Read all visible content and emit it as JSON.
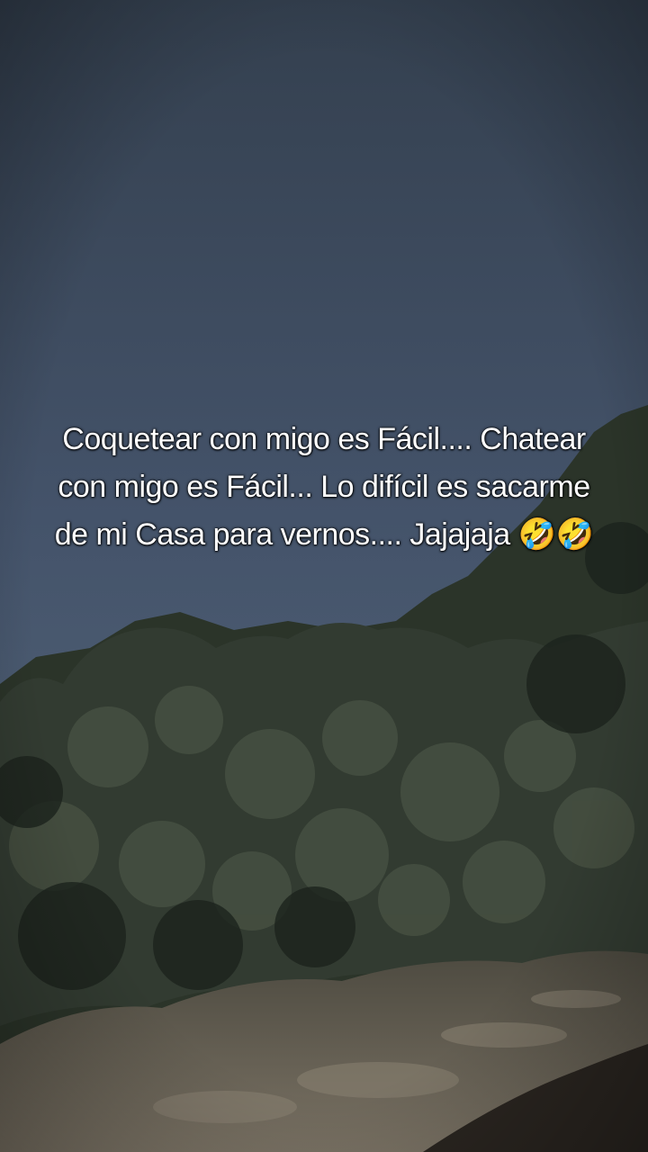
{
  "caption": {
    "text": "Coquetear con migo es Fácil.... Chatear con migo es Fácil... Lo difícil es sacarme de mi Casa para vernos.... Jajajaja 🤣🤣"
  },
  "colors": {
    "sky_top": "#3b4a5e",
    "sky_bottom": "#4a5a70",
    "foliage_dark": "#1e2620",
    "foliage_mid": "#3a4438",
    "bank": "#6e6658",
    "water": "#2a2520",
    "caption_text": "#ffffff"
  }
}
